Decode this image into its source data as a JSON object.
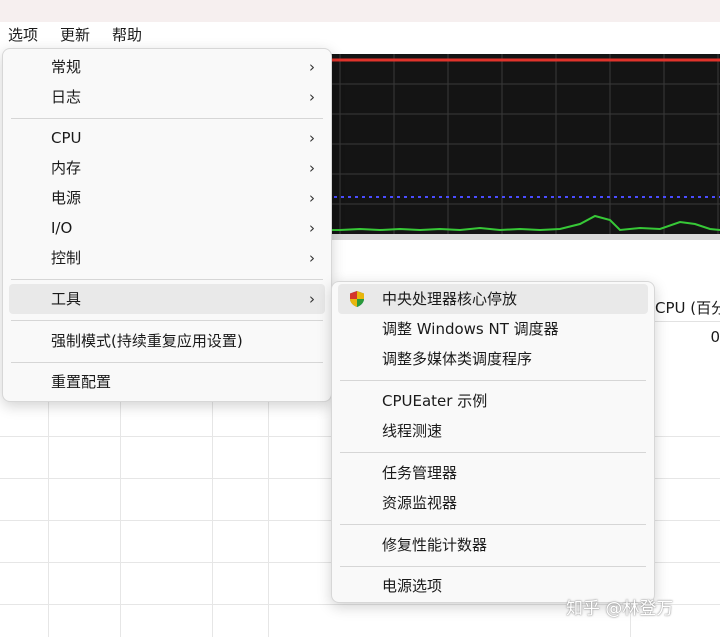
{
  "menubar": {
    "items": [
      "选项",
      "更新",
      "帮助"
    ]
  },
  "main_menu": {
    "items": [
      {
        "label": "常规",
        "submenu": true
      },
      {
        "label": "日志",
        "submenu": true
      },
      {
        "label": "CPU",
        "submenu": true
      },
      {
        "label": "内存",
        "submenu": true
      },
      {
        "label": "电源",
        "submenu": true
      },
      {
        "label": "I/O",
        "submenu": true
      },
      {
        "label": "控制",
        "submenu": true
      },
      {
        "label": "工具",
        "submenu": true,
        "highlighted": true
      },
      {
        "label": "强制模式(持续重复应用设置)",
        "submenu": false
      },
      {
        "label": "重置配置",
        "submenu": false
      }
    ],
    "arrow_glyph": "›"
  },
  "tools_submenu": {
    "items": [
      {
        "label": "中央处理器核心停放",
        "icon": "uac-shield-icon",
        "highlighted": true
      },
      {
        "label": "调整 Windows NT 调度器"
      },
      {
        "label": "调整多媒体类调度程序"
      },
      {
        "label": "CPUEater 示例"
      },
      {
        "label": "线程测速"
      },
      {
        "label": "任务管理器"
      },
      {
        "label": "资源监视器"
      },
      {
        "label": "修复性能计数器"
      },
      {
        "label": "电源选项"
      }
    ]
  },
  "table": {
    "header": "CPU (百分比)",
    "value": "0"
  },
  "watermark": "知乎 @林登万",
  "colors": {
    "graph_bg": "#141414",
    "grid_line": "#3a3a3a",
    "red_line": "#e0332b",
    "blue_dotted": "#4a4cff",
    "green_line": "#37c837",
    "menu_bg": "#f9f9f9",
    "highlight": "#e9e9e9"
  }
}
